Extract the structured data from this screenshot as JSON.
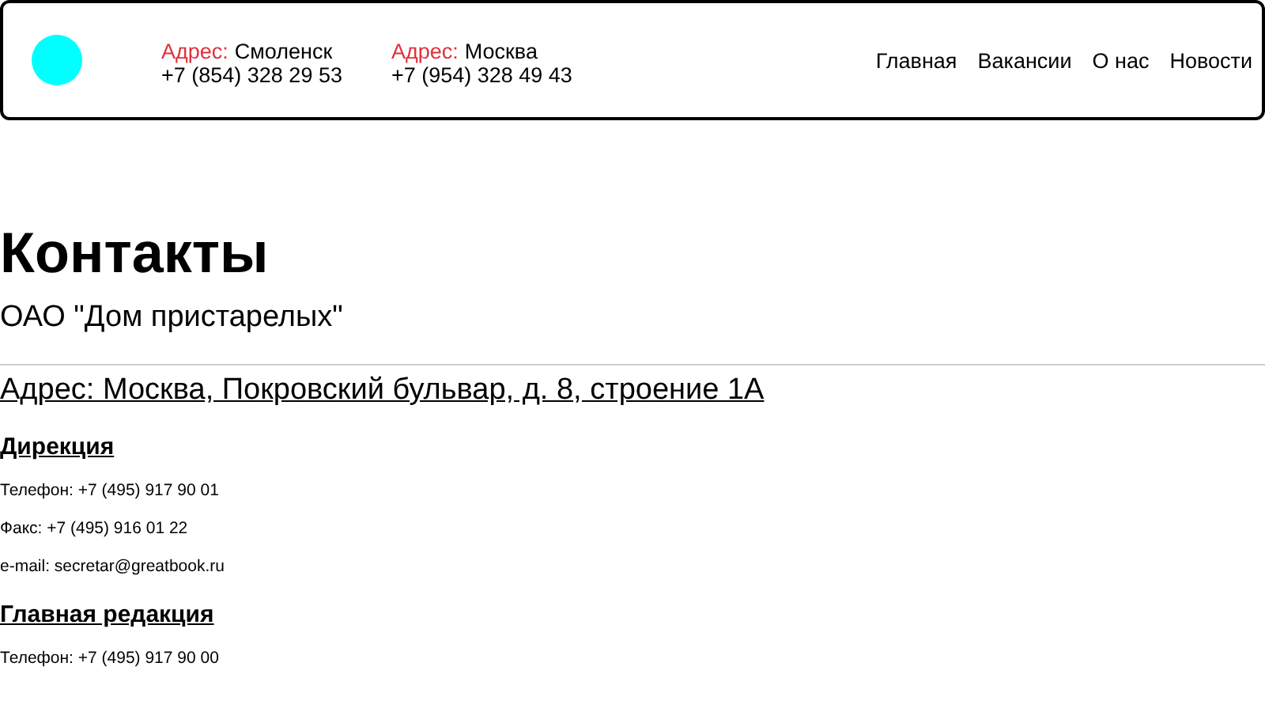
{
  "header": {
    "offices": [
      {
        "label": "Адрес:",
        "city": "Смоленск",
        "phone": "+7 (854) 328 29 53"
      },
      {
        "label": "Адрес:",
        "city": "Москва",
        "phone": "+7 (954) 328 49 43"
      }
    ],
    "nav": [
      {
        "label": "Главная"
      },
      {
        "label": "Вакансии"
      },
      {
        "label": "О нас"
      },
      {
        "label": "Новости"
      }
    ]
  },
  "title": "Контакты",
  "organization": "ОАО \"Дом пристарелых\"",
  "address": "Адрес: Москва, Покровский бульвар, д. 8, строение 1А",
  "sections": [
    {
      "heading": "Дирекция",
      "lines": [
        "Телефон: +7 (495) 917 90 01",
        "Факс: +7 (495) 916 01 22",
        "e-mail: secretar@greatbook.ru"
      ]
    },
    {
      "heading": "Главная редакция",
      "lines": [
        "Телефон: +7 (495) 917 90 00"
      ]
    }
  ]
}
